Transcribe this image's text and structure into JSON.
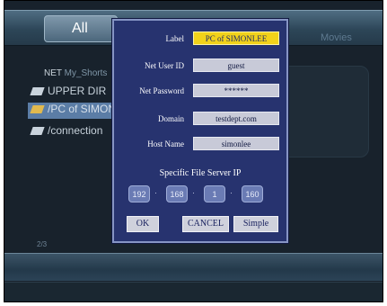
{
  "tabs": {
    "all_label": "All",
    "movies_label": "Movies"
  },
  "breadcrumb": {
    "root": "NET",
    "current": "My_Shorts"
  },
  "file_list": [
    {
      "label": "UPPER DIR"
    },
    {
      "label": "/PC of SIMONLEE",
      "selected": true
    },
    {
      "label": "/connection"
    }
  ],
  "page_counter": "2/3",
  "dialog": {
    "fields": [
      {
        "label": "Label",
        "value": "PC of SIMONLEE",
        "active": true
      },
      {
        "label": "Net User ID",
        "value": "guest"
      },
      {
        "label": "Net Password",
        "value": "******"
      },
      {
        "label": "Domain",
        "value": "testdept.com"
      },
      {
        "label": "Host Name",
        "value": "simonlee"
      }
    ],
    "ip_title": "Specific File Server IP",
    "ip": [
      "192",
      "168",
      "1",
      "160"
    ],
    "buttons": {
      "ok": "OK",
      "cancel": "CANCEL",
      "simple": "Simple"
    }
  },
  "colors": {
    "dialog_bg": "#27336f",
    "active_field": "#f2d21a",
    "selected_row": "#5b7da6"
  }
}
